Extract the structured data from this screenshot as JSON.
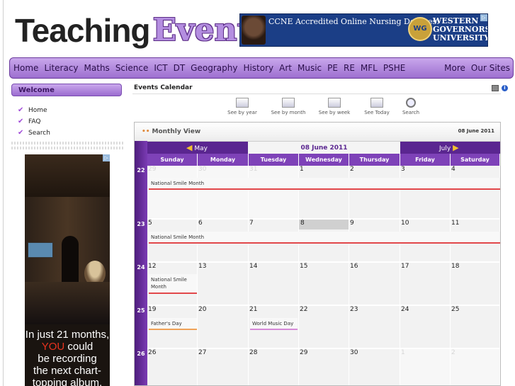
{
  "header": {
    "logo_part1": "Teaching",
    "logo_part2": "Events",
    "banner_text": "CCNE Accredited Online Nursing Degrees.",
    "banner_seal": "WG",
    "banner_uni_line1": "WESTERN",
    "banner_uni_line2": "GOVERNORS",
    "banner_uni_line3": "UNIVERSITY"
  },
  "nav": {
    "items": [
      "Home",
      "Literacy",
      "Maths",
      "Science",
      "ICT",
      "DT",
      "Geography",
      "History",
      "Art",
      "Music",
      "PE",
      "RE",
      "MFL",
      "PSHE"
    ],
    "right_items": [
      "More",
      "Our Sites"
    ]
  },
  "sidebar": {
    "welcome": "Welcome",
    "menu": [
      "Home",
      "FAQ",
      "Search"
    ],
    "ad_line1": "In just 21 months,",
    "ad_line2": "YOU",
    "ad_line2b": "could",
    "ad_line3": "be recording",
    "ad_line4": "the next chart-",
    "ad_line5": "topping album."
  },
  "main": {
    "title": "Events Calendar",
    "toolbar": [
      "See by year",
      "See by month",
      "See by week",
      "See Today",
      "Search"
    ]
  },
  "calendar": {
    "view_title": "Monthly View",
    "current_date": "08 June 2011",
    "prev_month": "May",
    "next_month": "July",
    "current_label": "08 June 2011",
    "days": [
      "Sunday",
      "Monday",
      "Tuesday",
      "Wednesday",
      "Thursday",
      "Friday",
      "Saturday"
    ],
    "weeks": [
      {
        "num": "22",
        "days": [
          "29",
          "30",
          "31",
          "1",
          "2",
          "3",
          "4"
        ]
      },
      {
        "num": "23",
        "days": [
          "5",
          "6",
          "7",
          "8",
          "9",
          "10",
          "11"
        ]
      },
      {
        "num": "24",
        "days": [
          "12",
          "13",
          "14",
          "15",
          "16",
          "17",
          "18"
        ]
      },
      {
        "num": "25",
        "days": [
          "19",
          "20",
          "21",
          "22",
          "23",
          "24",
          "25"
        ]
      },
      {
        "num": "26",
        "days": [
          "26",
          "27",
          "28",
          "29",
          "30",
          "1",
          "2"
        ]
      }
    ],
    "events": {
      "smile_w22": "National Smile Month",
      "smile_w23": "National Smile Month",
      "smile_w24": "National Smile Month",
      "fathers_day": "Father's Day",
      "world_music_day": "World Music Day"
    }
  }
}
